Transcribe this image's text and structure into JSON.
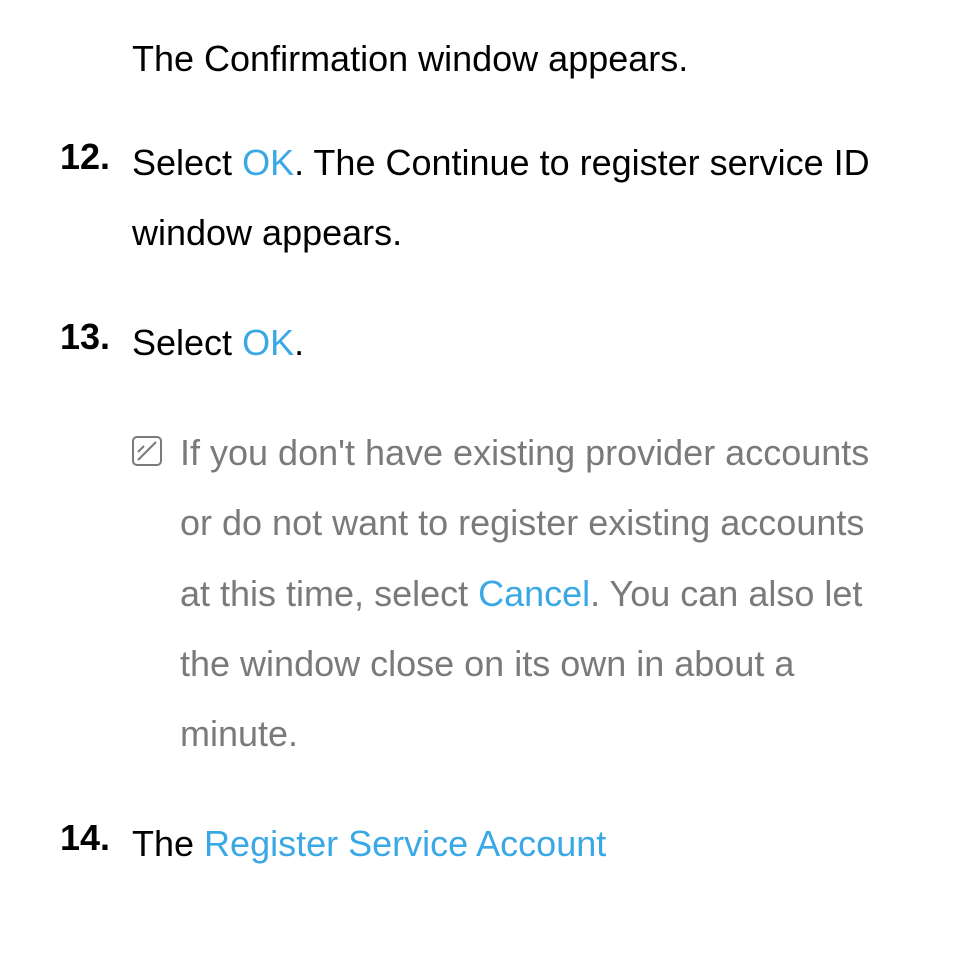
{
  "intro": "The Confirmation window appears.",
  "steps": {
    "s12": {
      "number": "12.",
      "prefix": "Select ",
      "link1": "OK",
      "suffix": ". The Continue to register service ID window appears."
    },
    "s13": {
      "number": "13.",
      "prefix": "Select ",
      "link1": "OK",
      "suffix": "."
    },
    "s14": {
      "number": "14.",
      "prefix": "The ",
      "link1": "Register Service Account"
    }
  },
  "note": {
    "prefix": "If you don't have existing provider accounts or do not want to register existing accounts at this time, select ",
    "link1": "Cancel",
    "suffix": ". You can also let the window close on its own in about a minute."
  }
}
